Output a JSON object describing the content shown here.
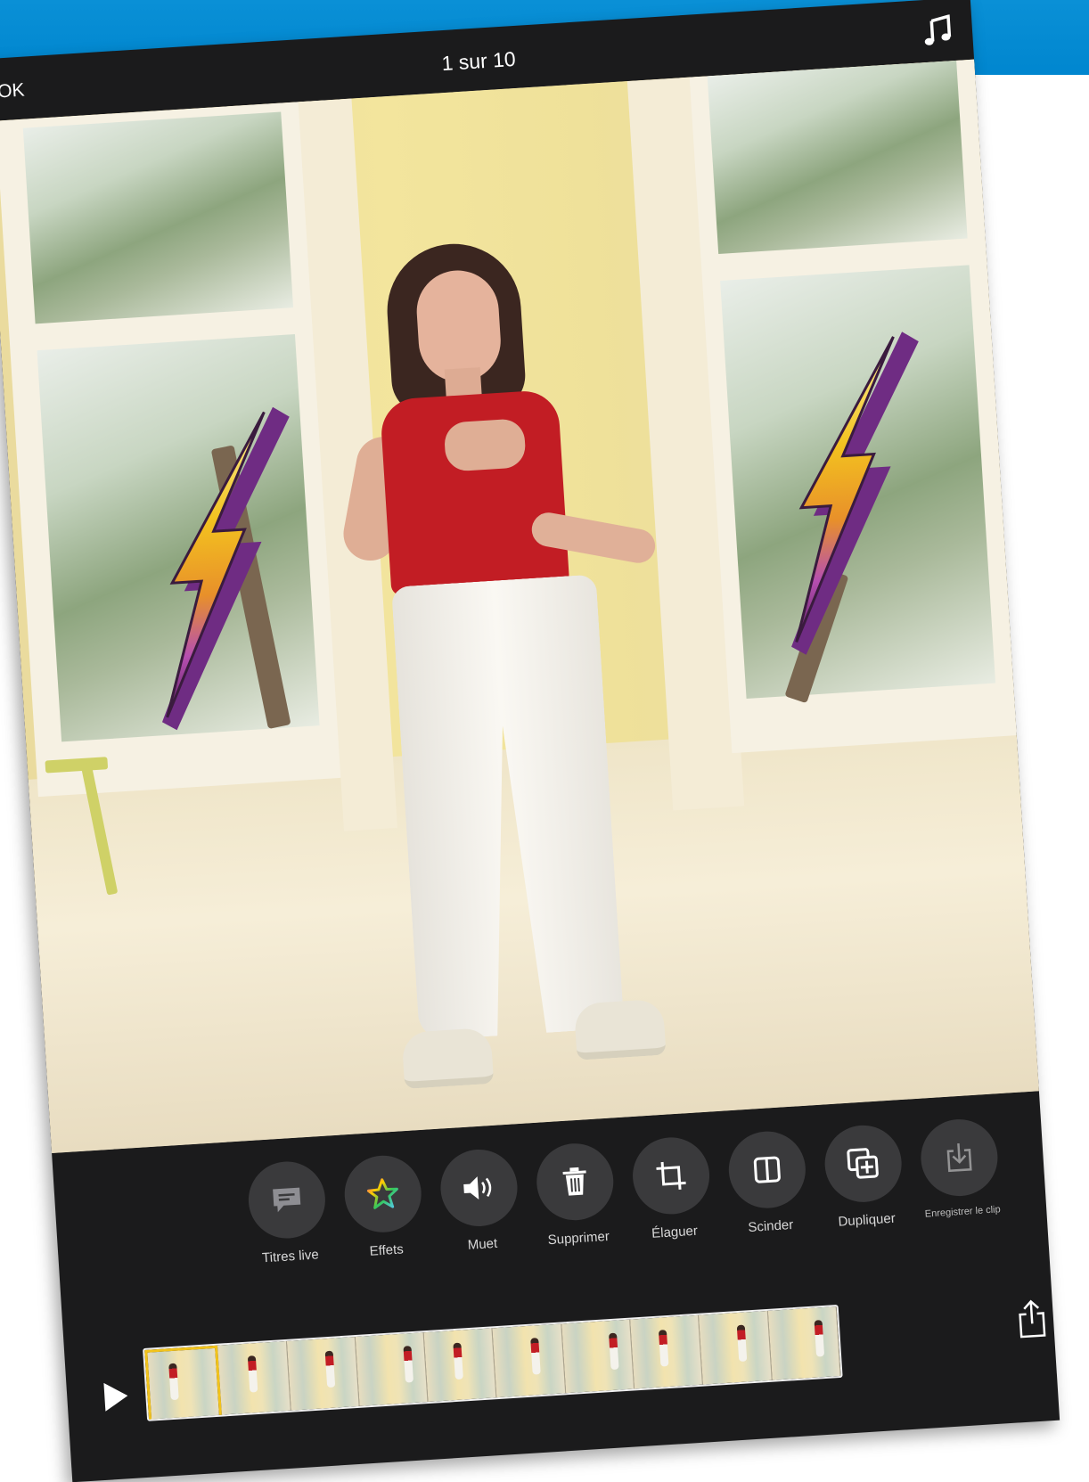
{
  "header": {
    "ok_label": "OK",
    "title": "1 sur 10",
    "music_icon": "music-note-icon"
  },
  "toolbar": {
    "items": [
      {
        "label": "Titres live",
        "icon": "speech-bubble-icon"
      },
      {
        "label": "Effets",
        "icon": "star-icon"
      },
      {
        "label": "Muet",
        "icon": "speaker-icon"
      },
      {
        "label": "Supprimer",
        "icon": "trash-icon"
      },
      {
        "label": "Élaguer",
        "icon": "crop-icon"
      },
      {
        "label": "Scinder",
        "icon": "split-icon"
      },
      {
        "label": "Dupliquer",
        "icon": "duplicate-icon"
      },
      {
        "label": "Enregistrer le clip",
        "icon": "save-clip-icon"
      }
    ]
  },
  "timeline": {
    "play_icon": "play-icon",
    "clip_count": 10,
    "share_icon": "share-icon"
  },
  "colors": {
    "top_band": "#0086cf",
    "app_background": "#1b1b1c",
    "button_circle": "#3a3a3c",
    "selected_clip_border": "#f2c31b"
  }
}
